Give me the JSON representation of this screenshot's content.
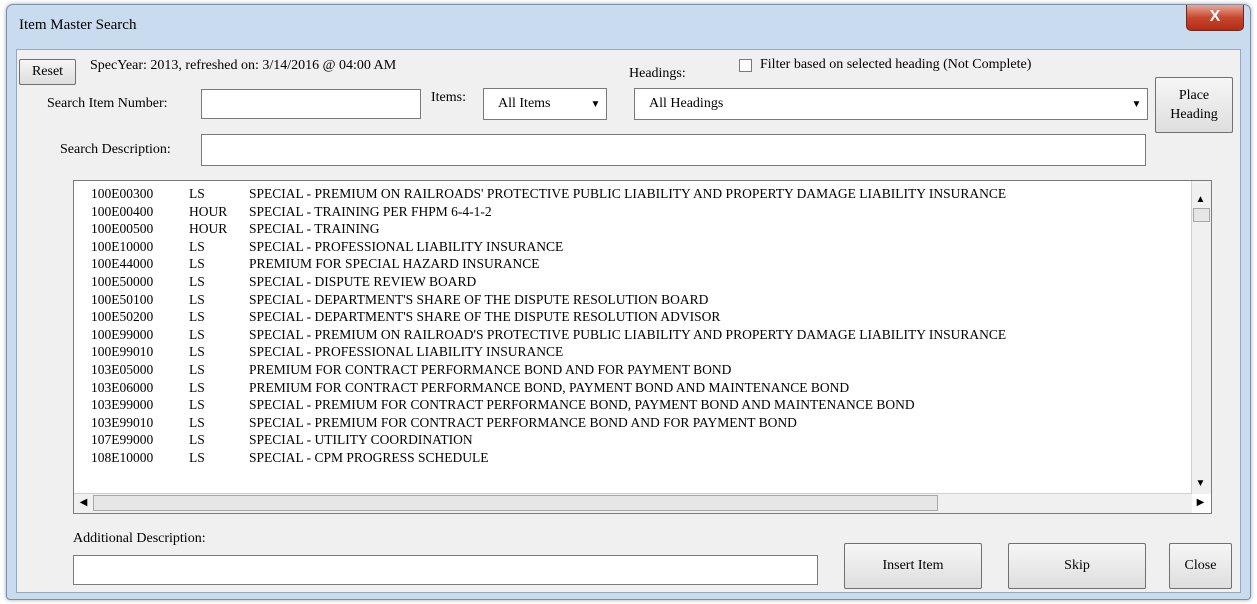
{
  "window": {
    "title": "Item Master Search",
    "close_glyph": "X"
  },
  "toolbar": {
    "reset_label": "Reset",
    "spec_info": "SpecYear: 2013, refreshed on: 3/14/2016 @ 04:00 AM",
    "filter_label": "Filter based on selected heading (Not Complete)",
    "filter_checked": false,
    "place_heading_line1": "Place",
    "place_heading_line2": "Heading"
  },
  "search": {
    "item_number_label": "Search Item Number:",
    "item_number_value": "",
    "items_label": "Items:",
    "items_selected": "All Items",
    "headings_label": "Headings:",
    "headings_selected": "All Headings",
    "description_label": "Search Description:",
    "description_value": ""
  },
  "results": [
    {
      "item": "100E00300",
      "unit": "LS",
      "desc": "SPECIAL - PREMIUM ON RAILROADS' PROTECTIVE PUBLIC LIABILITY AND PROPERTY DAMAGE LIABILITY INSURANCE"
    },
    {
      "item": "100E00400",
      "unit": "HOUR",
      "desc": "SPECIAL - TRAINING PER FHPM 6-4-1-2"
    },
    {
      "item": "100E00500",
      "unit": "HOUR",
      "desc": "SPECIAL - TRAINING"
    },
    {
      "item": "100E10000",
      "unit": "LS",
      "desc": "SPECIAL - PROFESSIONAL LIABILITY INSURANCE"
    },
    {
      "item": "100E44000",
      "unit": "LS",
      "desc": "PREMIUM FOR SPECIAL HAZARD INSURANCE"
    },
    {
      "item": "100E50000",
      "unit": "LS",
      "desc": "SPECIAL - DISPUTE REVIEW BOARD"
    },
    {
      "item": "100E50100",
      "unit": "LS",
      "desc": "SPECIAL - DEPARTMENT'S SHARE OF THE DISPUTE RESOLUTION BOARD"
    },
    {
      "item": "100E50200",
      "unit": "LS",
      "desc": "SPECIAL - DEPARTMENT'S SHARE OF THE DISPUTE RESOLUTION ADVISOR"
    },
    {
      "item": "100E99000",
      "unit": "LS",
      "desc": "SPECIAL - PREMIUM ON RAILROAD'S PROTECTIVE PUBLIC LIABILITY AND PROPERTY DAMAGE LIABILITY INSURANCE"
    },
    {
      "item": "100E99010",
      "unit": "LS",
      "desc": "SPECIAL - PROFESSIONAL LIABILITY INSURANCE"
    },
    {
      "item": "103E05000",
      "unit": "LS",
      "desc": "PREMIUM FOR CONTRACT PERFORMANCE BOND AND FOR PAYMENT BOND"
    },
    {
      "item": "103E06000",
      "unit": "LS",
      "desc": "PREMIUM FOR CONTRACT PERFORMANCE BOND, PAYMENT BOND AND MAINTENANCE BOND"
    },
    {
      "item": "103E99000",
      "unit": "LS",
      "desc": "SPECIAL - PREMIUM FOR CONTRACT PERFORMANCE BOND, PAYMENT BOND AND MAINTENANCE BOND"
    },
    {
      "item": "103E99010",
      "unit": "LS",
      "desc": "SPECIAL - PREMIUM FOR CONTRACT PERFORMANCE BOND AND FOR PAYMENT BOND"
    },
    {
      "item": "107E99000",
      "unit": "LS",
      "desc": "SPECIAL - UTILITY COORDINATION"
    },
    {
      "item": "108E10000",
      "unit": "LS",
      "desc": "SPECIAL - CPM PROGRESS SCHEDULE"
    }
  ],
  "footer": {
    "additional_label": "Additional Description:",
    "additional_value": "",
    "insert_label": "Insert Item",
    "skip_label": "Skip",
    "close_label": "Close"
  },
  "icons": {
    "scroll_up": "▲",
    "scroll_down": "▼",
    "scroll_left": "◀",
    "scroll_right": "▶",
    "dropdown": "▼"
  }
}
